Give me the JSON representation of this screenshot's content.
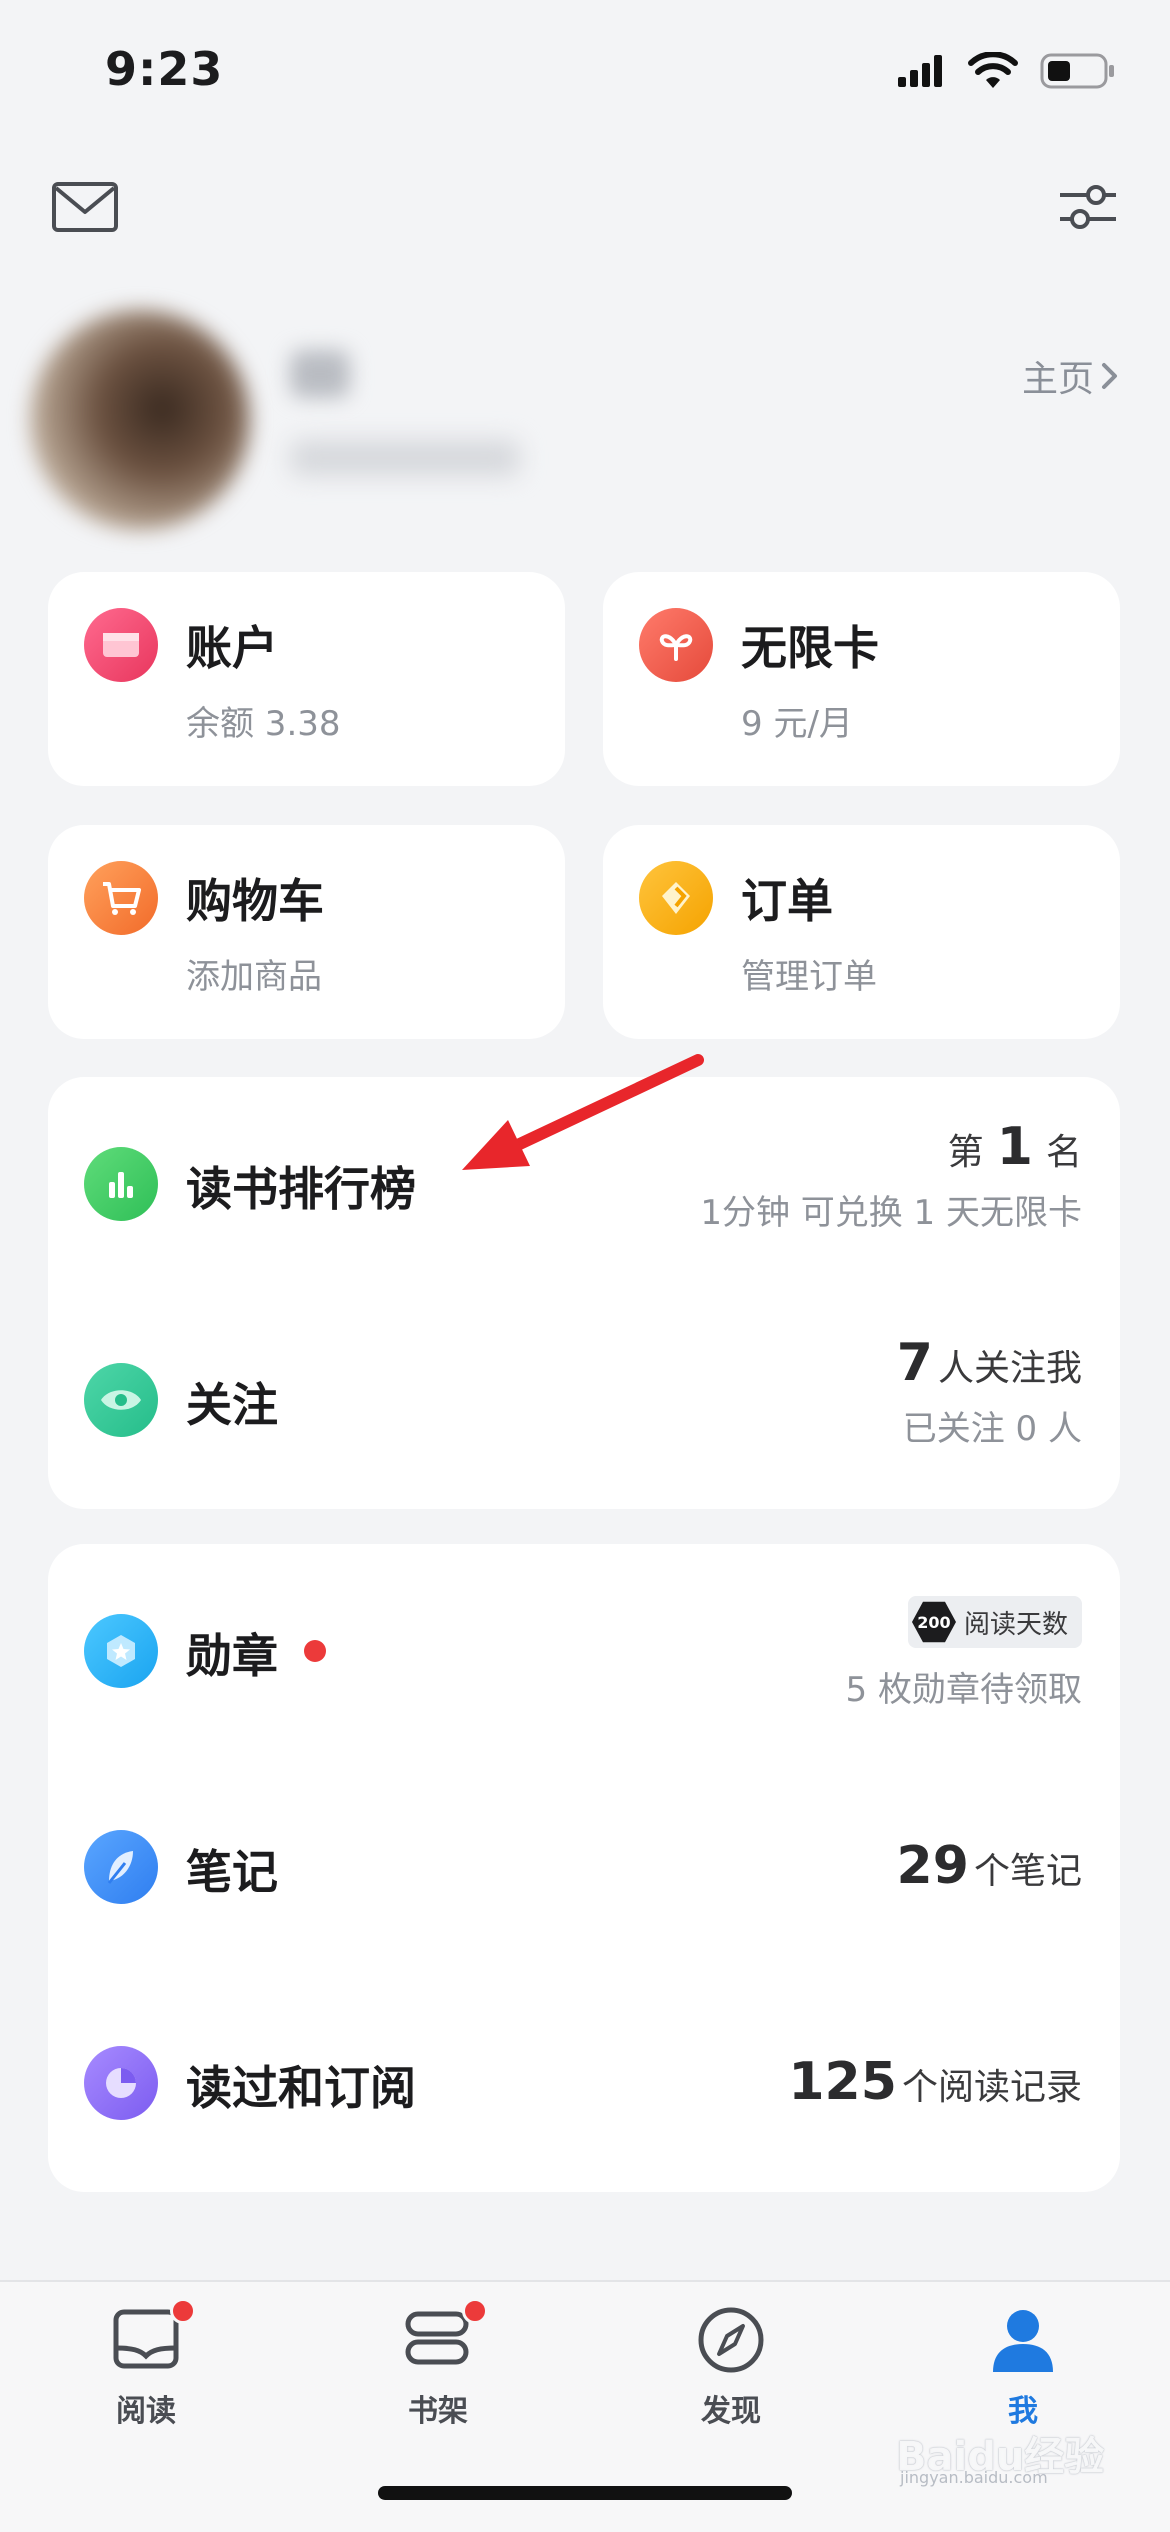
{
  "status_bar": {
    "time": "9:23"
  },
  "profile": {
    "homepage_link": "主页"
  },
  "cards": {
    "account": {
      "title": "账户",
      "subtitle": "余额 3.38"
    },
    "unlimited_card": {
      "title": "无限卡",
      "subtitle": "9 元/月"
    },
    "cart": {
      "title": "购物车",
      "subtitle": "添加商品"
    },
    "orders": {
      "title": "订单",
      "subtitle": "管理订单"
    }
  },
  "social": {
    "ranking": {
      "title": "读书排行榜",
      "rank_prefix": "第",
      "rank_value": "1",
      "rank_suffix": "名",
      "hint": "1分钟 可兑换 1 天无限卡"
    },
    "follow": {
      "title": "关注",
      "followers_count": "7",
      "followers_label": "人关注我",
      "following_text": "已关注 0 人"
    }
  },
  "records": {
    "medals": {
      "title": "勋章",
      "badge_number": "200",
      "badge_label": "阅读天数",
      "pending": "5 枚勋章待领取"
    },
    "notes": {
      "title": "笔记",
      "count": "29",
      "label": "个笔记"
    },
    "history": {
      "title": "读过和订阅",
      "count": "125",
      "label": "个阅读记录"
    }
  },
  "tabbar": {
    "tabs": [
      {
        "label": "阅读",
        "icon": "book-open-icon",
        "has_dot": true
      },
      {
        "label": "书架",
        "icon": "bookshelf-icon",
        "has_dot": true
      },
      {
        "label": "发现",
        "icon": "compass-icon",
        "has_dot": false
      },
      {
        "label": "我",
        "icon": "person-icon",
        "has_dot": false,
        "active": true
      }
    ]
  },
  "watermark": {
    "text": "Baidu经验",
    "sub": "jingyan.baidu.com"
  },
  "colors": {
    "background": "#f3f4f6",
    "card": "#ffffff",
    "active_tab": "#1f7ae0",
    "red_dot": "#ec3a3a",
    "arrow": "#e8262b"
  }
}
